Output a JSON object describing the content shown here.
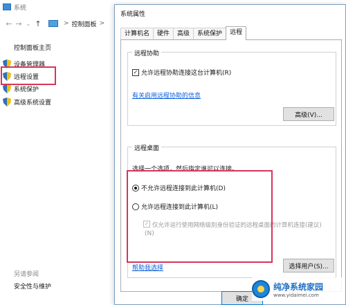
{
  "background_window": {
    "title": "系统",
    "breadcrumb": {
      "root": "控制面板",
      "separator": ">"
    },
    "left_panel": {
      "home": "控制面板主页",
      "items": [
        "设备管理器",
        "远程设置",
        "系统保护",
        "高级系统设置"
      ],
      "see_also_title": "另请参阅",
      "see_also_items": [
        "安全性与维护"
      ]
    }
  },
  "dialog": {
    "title": "系统属性",
    "tabs": [
      "计算机名",
      "硬件",
      "高级",
      "系统保护",
      "远程"
    ],
    "active_tab": "远程",
    "remote_assistance": {
      "title": "远程协助",
      "checkbox_label": "允许远程协助连接这台计算机(R)",
      "checkbox_checked": true,
      "info_link": "有关启用远程协助的信息",
      "advanced_button": "高级(V)..."
    },
    "remote_desktop": {
      "title": "远程桌面",
      "instruction": "选择一个选项，然后指定谁可以连接。",
      "options": [
        {
          "label": "不允许远程连接到此计算机(D)",
          "selected": true
        },
        {
          "label": "允许远程连接到此计算机(L)",
          "selected": false
        }
      ],
      "nla_checkbox_line1": "仅允许运行使用网络级别身份验证的远程桌面的计算机连接(建议)",
      "nla_checkbox_line2": "(N)",
      "help_link": "帮助我选择",
      "select_users_button": "选择用户(S)..."
    },
    "ok_button": "确定"
  },
  "watermark": {
    "name": "纯净系统家园",
    "url": "www.yidaimei.com"
  },
  "colors": {
    "highlight": "#d63458",
    "link": "#0b5ed7",
    "shield_blue": "#2e6fc0",
    "shield_yellow": "#f2c200"
  }
}
